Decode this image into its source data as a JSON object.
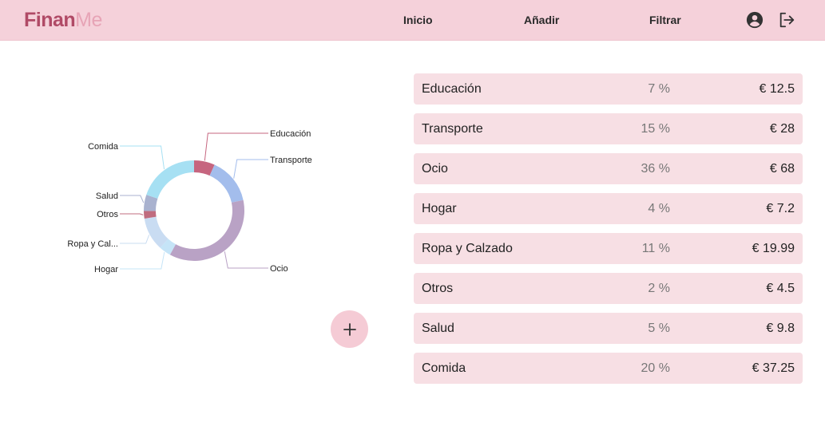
{
  "header": {
    "brand_part1": "Finan",
    "brand_part2": "Me",
    "nav": {
      "inicio": "Inicio",
      "anadir": "Añadir",
      "filtrar": "Filtrar"
    },
    "icons": {
      "account": "account-circle-icon",
      "logout": "logout-icon"
    }
  },
  "fab": {
    "label": "+",
    "icon": "plus-icon"
  },
  "chart_data": {
    "type": "pie",
    "subtype": "donut",
    "slices": [
      {
        "label": "Educación",
        "value": 12.5,
        "color": "#c6657f"
      },
      {
        "label": "Transporte",
        "value": 28,
        "color": "#a3bdec"
      },
      {
        "label": "Ocio",
        "value": 68,
        "color": "#b9a2c5"
      },
      {
        "label": "Hogar",
        "value": 7.2,
        "color": "#c5e4f7"
      },
      {
        "label": "Ropa y Cal...",
        "value": 19.99,
        "color": "#c9dcf2"
      },
      {
        "label": "Otros",
        "value": 4.5,
        "color": "#c06c7f"
      },
      {
        "label": "Salud",
        "value": 9.8,
        "color": "#a9b2cf"
      },
      {
        "label": "Comida",
        "value": 37.25,
        "color": "#a6e0f3"
      }
    ]
  },
  "categories": [
    {
      "name": "Educación",
      "percent": "7 %",
      "amount": "€ 12.5"
    },
    {
      "name": "Transporte",
      "percent": "15 %",
      "amount": "€ 28"
    },
    {
      "name": "Ocio",
      "percent": "36 %",
      "amount": "€ 68"
    },
    {
      "name": "Hogar",
      "percent": "4 %",
      "amount": "€ 7.2"
    },
    {
      "name": "Ropa y Calzado",
      "percent": "11 %",
      "amount": "€ 19.99"
    },
    {
      "name": "Otros",
      "percent": "2 %",
      "amount": "€ 4.5"
    },
    {
      "name": "Salud",
      "percent": "5 %",
      "amount": "€ 9.8"
    },
    {
      "name": "Comida",
      "percent": "20 %",
      "amount": "€ 37.25"
    }
  ]
}
